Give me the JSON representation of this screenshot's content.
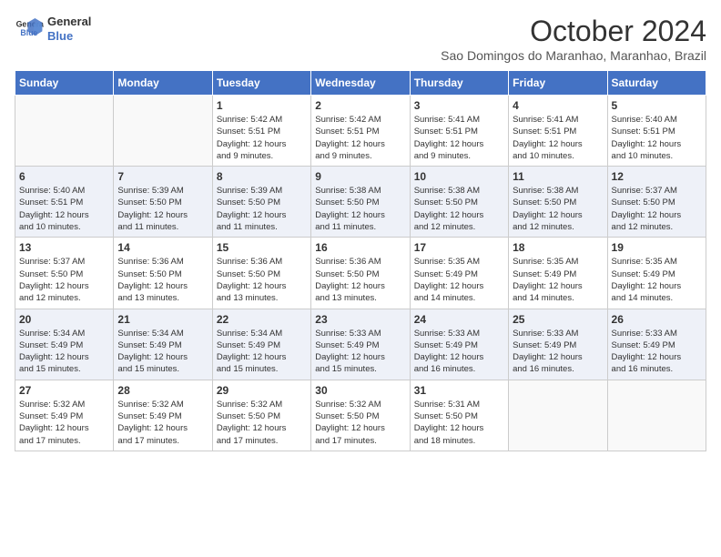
{
  "header": {
    "logo_line1": "General",
    "logo_line2": "Blue",
    "month": "October 2024",
    "location": "Sao Domingos do Maranhao, Maranhao, Brazil"
  },
  "days_of_week": [
    "Sunday",
    "Monday",
    "Tuesday",
    "Wednesday",
    "Thursday",
    "Friday",
    "Saturday"
  ],
  "weeks": [
    [
      {
        "day": "",
        "info": ""
      },
      {
        "day": "",
        "info": ""
      },
      {
        "day": "1",
        "info": "Sunrise: 5:42 AM\nSunset: 5:51 PM\nDaylight: 12 hours\nand 9 minutes."
      },
      {
        "day": "2",
        "info": "Sunrise: 5:42 AM\nSunset: 5:51 PM\nDaylight: 12 hours\nand 9 minutes."
      },
      {
        "day": "3",
        "info": "Sunrise: 5:41 AM\nSunset: 5:51 PM\nDaylight: 12 hours\nand 9 minutes."
      },
      {
        "day": "4",
        "info": "Sunrise: 5:41 AM\nSunset: 5:51 PM\nDaylight: 12 hours\nand 10 minutes."
      },
      {
        "day": "5",
        "info": "Sunrise: 5:40 AM\nSunset: 5:51 PM\nDaylight: 12 hours\nand 10 minutes."
      }
    ],
    [
      {
        "day": "6",
        "info": "Sunrise: 5:40 AM\nSunset: 5:51 PM\nDaylight: 12 hours\nand 10 minutes."
      },
      {
        "day": "7",
        "info": "Sunrise: 5:39 AM\nSunset: 5:50 PM\nDaylight: 12 hours\nand 11 minutes."
      },
      {
        "day": "8",
        "info": "Sunrise: 5:39 AM\nSunset: 5:50 PM\nDaylight: 12 hours\nand 11 minutes."
      },
      {
        "day": "9",
        "info": "Sunrise: 5:38 AM\nSunset: 5:50 PM\nDaylight: 12 hours\nand 11 minutes."
      },
      {
        "day": "10",
        "info": "Sunrise: 5:38 AM\nSunset: 5:50 PM\nDaylight: 12 hours\nand 12 minutes."
      },
      {
        "day": "11",
        "info": "Sunrise: 5:38 AM\nSunset: 5:50 PM\nDaylight: 12 hours\nand 12 minutes."
      },
      {
        "day": "12",
        "info": "Sunrise: 5:37 AM\nSunset: 5:50 PM\nDaylight: 12 hours\nand 12 minutes."
      }
    ],
    [
      {
        "day": "13",
        "info": "Sunrise: 5:37 AM\nSunset: 5:50 PM\nDaylight: 12 hours\nand 12 minutes."
      },
      {
        "day": "14",
        "info": "Sunrise: 5:36 AM\nSunset: 5:50 PM\nDaylight: 12 hours\nand 13 minutes."
      },
      {
        "day": "15",
        "info": "Sunrise: 5:36 AM\nSunset: 5:50 PM\nDaylight: 12 hours\nand 13 minutes."
      },
      {
        "day": "16",
        "info": "Sunrise: 5:36 AM\nSunset: 5:50 PM\nDaylight: 12 hours\nand 13 minutes."
      },
      {
        "day": "17",
        "info": "Sunrise: 5:35 AM\nSunset: 5:49 PM\nDaylight: 12 hours\nand 14 minutes."
      },
      {
        "day": "18",
        "info": "Sunrise: 5:35 AM\nSunset: 5:49 PM\nDaylight: 12 hours\nand 14 minutes."
      },
      {
        "day": "19",
        "info": "Sunrise: 5:35 AM\nSunset: 5:49 PM\nDaylight: 12 hours\nand 14 minutes."
      }
    ],
    [
      {
        "day": "20",
        "info": "Sunrise: 5:34 AM\nSunset: 5:49 PM\nDaylight: 12 hours\nand 15 minutes."
      },
      {
        "day": "21",
        "info": "Sunrise: 5:34 AM\nSunset: 5:49 PM\nDaylight: 12 hours\nand 15 minutes."
      },
      {
        "day": "22",
        "info": "Sunrise: 5:34 AM\nSunset: 5:49 PM\nDaylight: 12 hours\nand 15 minutes."
      },
      {
        "day": "23",
        "info": "Sunrise: 5:33 AM\nSunset: 5:49 PM\nDaylight: 12 hours\nand 15 minutes."
      },
      {
        "day": "24",
        "info": "Sunrise: 5:33 AM\nSunset: 5:49 PM\nDaylight: 12 hours\nand 16 minutes."
      },
      {
        "day": "25",
        "info": "Sunrise: 5:33 AM\nSunset: 5:49 PM\nDaylight: 12 hours\nand 16 minutes."
      },
      {
        "day": "26",
        "info": "Sunrise: 5:33 AM\nSunset: 5:49 PM\nDaylight: 12 hours\nand 16 minutes."
      }
    ],
    [
      {
        "day": "27",
        "info": "Sunrise: 5:32 AM\nSunset: 5:49 PM\nDaylight: 12 hours\nand 17 minutes."
      },
      {
        "day": "28",
        "info": "Sunrise: 5:32 AM\nSunset: 5:49 PM\nDaylight: 12 hours\nand 17 minutes."
      },
      {
        "day": "29",
        "info": "Sunrise: 5:32 AM\nSunset: 5:50 PM\nDaylight: 12 hours\nand 17 minutes."
      },
      {
        "day": "30",
        "info": "Sunrise: 5:32 AM\nSunset: 5:50 PM\nDaylight: 12 hours\nand 17 minutes."
      },
      {
        "day": "31",
        "info": "Sunrise: 5:31 AM\nSunset: 5:50 PM\nDaylight: 12 hours\nand 18 minutes."
      },
      {
        "day": "",
        "info": ""
      },
      {
        "day": "",
        "info": ""
      }
    ]
  ]
}
